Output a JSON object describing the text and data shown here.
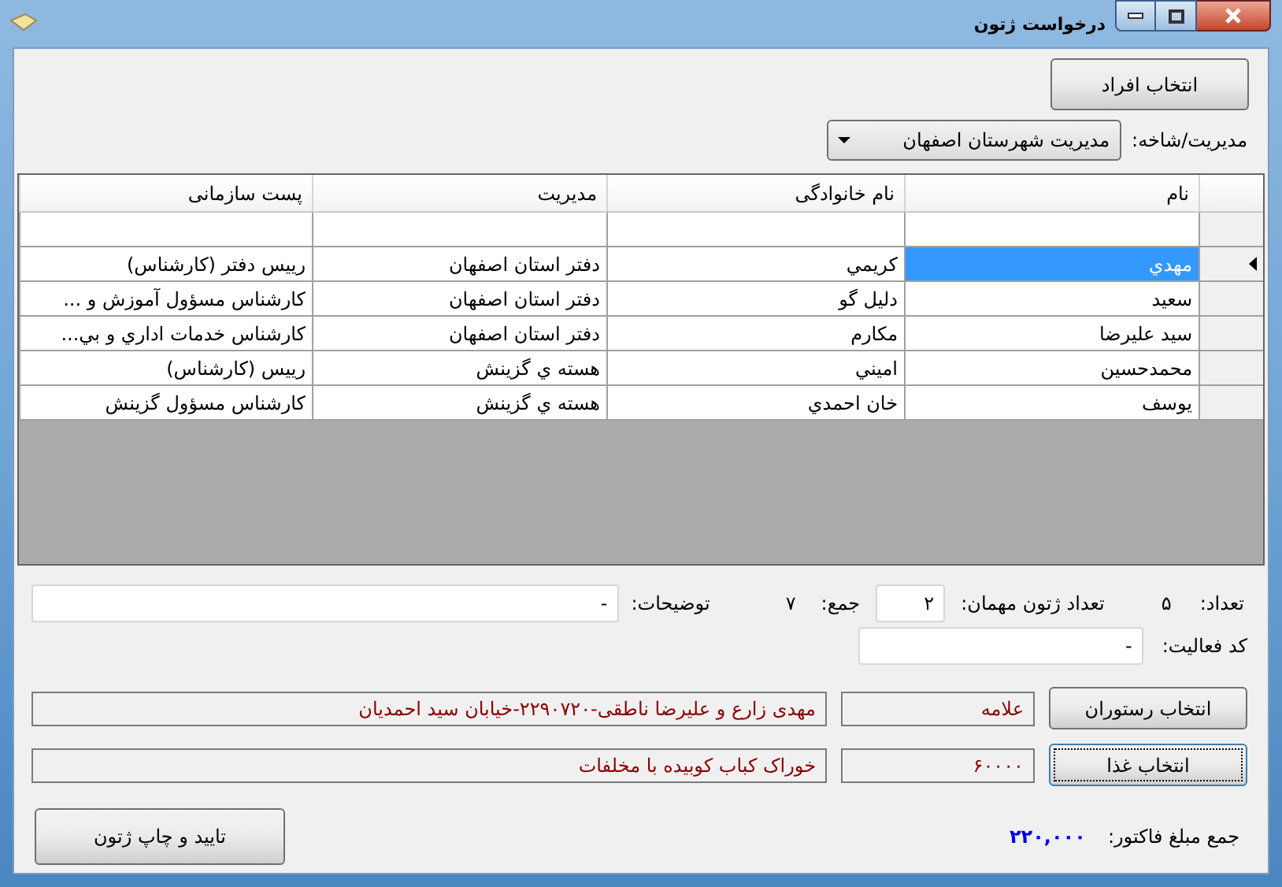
{
  "window": {
    "title": "درخواست ژتون"
  },
  "select_people_button": {
    "label": "انتخاب افراد",
    "focused": false
  },
  "branch": {
    "label": "مدیریت/شاخه:",
    "value": "مدیریت شهرستان اصفهان"
  },
  "table": {
    "columns": [
      "نام",
      "نام خانوادگی",
      "مدیریت",
      "پست سازمانی"
    ],
    "rows": [
      {
        "kind": "new",
        "selected": false
      },
      {
        "kind": "data",
        "selected": true,
        "cells": [
          "مهدي",
          "كريمي",
          "دفتر استان اصفهان",
          "رييس دفتر (كارشناس)"
        ]
      },
      {
        "kind": "data",
        "selected": false,
        "cells": [
          "سعيد",
          "دليل گو",
          "دفتر استان اصفهان",
          "كارشناس مسؤول آموزش و ..."
        ]
      },
      {
        "kind": "data",
        "selected": false,
        "cells": [
          "سيد عليرضا",
          "مكارم",
          "دفتر استان اصفهان",
          "كارشناس خدمات اداري و بي..."
        ]
      },
      {
        "kind": "data",
        "selected": false,
        "cells": [
          "محمدحسين",
          "اميني",
          "هسته ي گزينش",
          "رييس (كارشناس)"
        ]
      },
      {
        "kind": "data",
        "selected": false,
        "cells": [
          "يوسف",
          "خان احمدي",
          "هسته ي گزينش",
          "كارشناس مسؤول گزينش"
        ]
      }
    ]
  },
  "count": {
    "label": "تعداد:",
    "value": "۵"
  },
  "guest_tickets": {
    "label": "تعداد ژتون مهمان:",
    "value": "۲"
  },
  "sum": {
    "label": "جمع:",
    "value": "۷"
  },
  "notes": {
    "label": "توضیحات:",
    "value": "-"
  },
  "activity_code": {
    "label": "کد فعالیت:",
    "value": "-"
  },
  "restaurant": {
    "button": {
      "label": "انتخاب رستوران",
      "focused": false
    },
    "name": "علامه",
    "details": "مهدی زارع و علیرضا ناطقی-۲۲۹۰۷۲۰-خیابان سید احمدیان"
  },
  "food": {
    "button": {
      "label": "انتخاب غذا",
      "focused": true
    },
    "price": "۶۰۰۰۰",
    "details": "خوراک کباب کوبیده با مخلفات"
  },
  "invoice_total": {
    "label": "جمع مبلغ فاکتور:",
    "value": "۲۲۰,۰۰۰"
  },
  "confirm_button": {
    "label": "تایید و چاپ ژتون",
    "focused": false
  }
}
